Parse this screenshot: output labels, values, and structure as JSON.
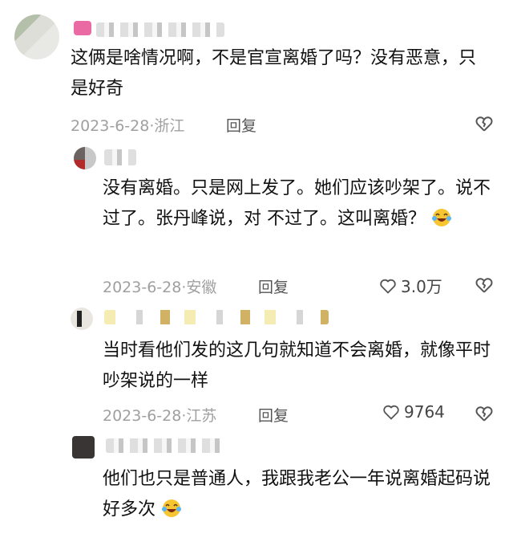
{
  "comments": [
    {
      "text": "这俩是啥情况啊，不是官宣离婚了吗？没有恶意，只是好奇",
      "date": "2023-6-28",
      "location": "浙江",
      "reply_label": "回复"
    },
    {
      "text": "没有离婚。只是网上发了。她们应该吵架了。说不过了。张丹峰说，对 不过了。这叫离婚？",
      "date": "2023-6-28",
      "location": "安徽",
      "reply_label": "回复",
      "likes": "3.0万",
      "emoji": "laughing-crying-emoji"
    },
    {
      "text": "当时看他们发的这几句就知道不会离婚，就像平时吵架说的一样",
      "date": "2023-6-28",
      "location": "江苏",
      "reply_label": "回复",
      "likes": "9764"
    },
    {
      "text": "他们也只是普通人，我跟我老公一年说离婚起码说好多次",
      "emoji": "laughing-crying-emoji"
    }
  ],
  "separator": "·",
  "icons": {
    "like": "heart-outline-icon",
    "dislike": "broken-heart-icon"
  },
  "colors": {
    "meta": "#a0a0a0",
    "text": "#111111"
  }
}
